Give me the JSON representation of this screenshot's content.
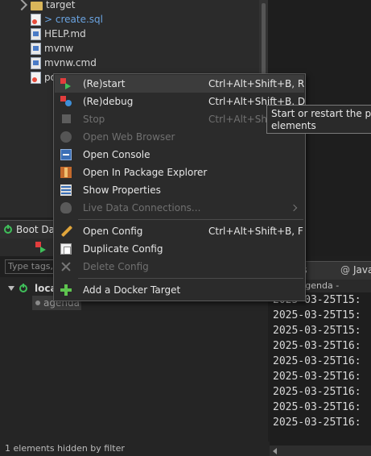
{
  "explorer": {
    "items": [
      {
        "label": "target",
        "icon": "folder-icon"
      },
      {
        "label": "> create.sql",
        "icon": "sql-file-icon"
      },
      {
        "label": "HELP.md",
        "icon": "markdown-file-icon"
      },
      {
        "label": "mvnw",
        "icon": "file-icon"
      },
      {
        "label": "mvnw.cmd",
        "icon": "cmd-file-icon"
      },
      {
        "label": "po",
        "icon": "xml-file-icon"
      }
    ]
  },
  "boot_dashboard": {
    "tab_label": "Boot Da",
    "tag_filter_placeholder": "Type tags,",
    "tree": [
      {
        "label": "loca"
      },
      {
        "label": "agenda"
      }
    ],
    "status": "1 elements hidden by filter"
  },
  "context_menu": {
    "items": [
      {
        "label": "(Re)start",
        "shortcut": "Ctrl+Alt+Shift+B, R",
        "icon": "restart-icon",
        "enabled": true,
        "highlighted": true
      },
      {
        "label": "(Re)debug",
        "shortcut": "Ctrl+Alt+Shift+B, D",
        "icon": "debug-icon",
        "enabled": true
      },
      {
        "label": "Stop",
        "shortcut": "Ctrl+Alt+Shift",
        "icon": "stop-icon",
        "enabled": false
      },
      {
        "label": "Open Web Browser",
        "shortcut": "",
        "icon": "globe-icon",
        "enabled": false
      },
      {
        "label": "Open Console",
        "shortcut": "",
        "icon": "console-icon",
        "enabled": true
      },
      {
        "label": "Open In Package Explorer",
        "shortcut": "",
        "icon": "package-explorer-icon",
        "enabled": true
      },
      {
        "label": "Show Properties",
        "shortcut": "",
        "icon": "properties-icon",
        "enabled": true
      },
      {
        "label": "Live Data Connections...",
        "shortcut": "",
        "icon": "lightbulb-icon",
        "enabled": false,
        "submenu": true
      },
      {
        "label": "Open Config",
        "shortcut": "Ctrl+Alt+Shift+B, F",
        "icon": "pencil-icon",
        "enabled": true
      },
      {
        "label": "Duplicate Config",
        "shortcut": "",
        "icon": "duplicate-icon",
        "enabled": true
      },
      {
        "label": "Delete Config",
        "shortcut": "",
        "icon": "delete-icon",
        "enabled": false
      },
      {
        "label": "Add a Docker Target",
        "shortcut": "",
        "icon": "add-icon",
        "enabled": true
      }
    ]
  },
  "tooltip": {
    "line1": "Start or restart the proce",
    "line2": "elements"
  },
  "console": {
    "tab1": "lems",
    "tab2": "Java",
    "subtitle": "ated> agenda -",
    "lines": [
      "2025-03-25T15:",
      "2025-03-25T15:",
      "2025-03-25T15:",
      "2025-03-25T16:",
      "2025-03-25T16:",
      "2025-03-25T16:",
      "2025-03-25T16:",
      "2025-03-25T16:",
      "2025-03-25T16:"
    ]
  },
  "colors": {
    "background": "#1f1f1f",
    "menu_bg": "#2b2b2b",
    "highlight": "#3c3c3c",
    "accent_green": "#3fbf5a",
    "accent_red": "#e23d3d",
    "link_blue": "#6aa3e0"
  }
}
